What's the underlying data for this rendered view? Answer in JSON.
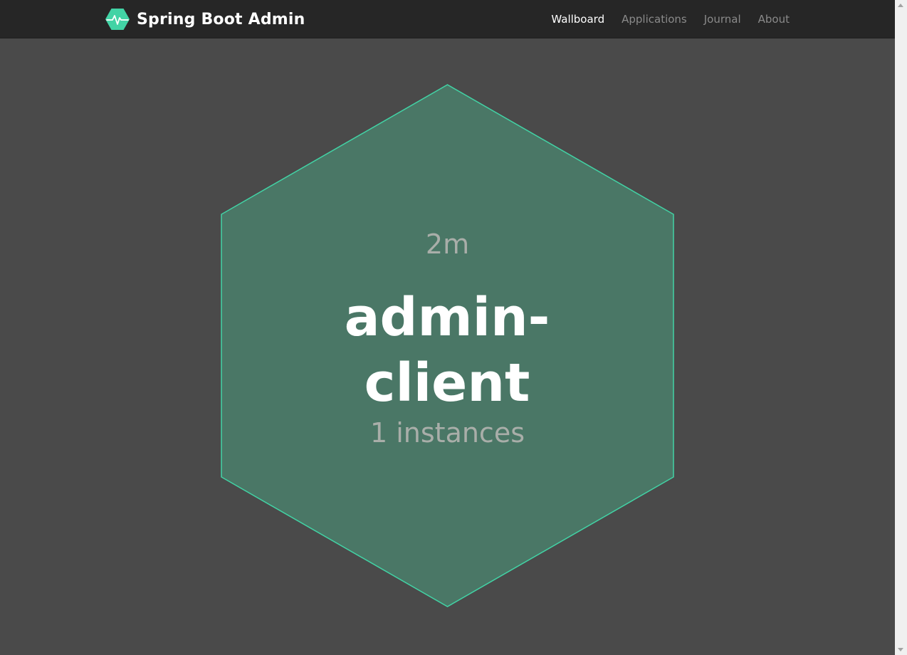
{
  "navbar": {
    "brand_title": "Spring Boot Admin",
    "brand_icon": "heartbeat-hexagon-icon",
    "items": [
      {
        "label": "Wallboard",
        "active": true
      },
      {
        "label": "Applications",
        "active": false
      },
      {
        "label": "Journal",
        "active": false
      },
      {
        "label": "About",
        "active": false
      }
    ]
  },
  "wallboard": {
    "application": {
      "time": "2m",
      "name": "admin-client",
      "instances": "1 instances",
      "status_color": "#42d3a5"
    }
  },
  "colors": {
    "background": "#4a4a4a",
    "navbar": "#262626",
    "hex_fill": "#4a7766",
    "hex_stroke": "#42d3a5"
  }
}
